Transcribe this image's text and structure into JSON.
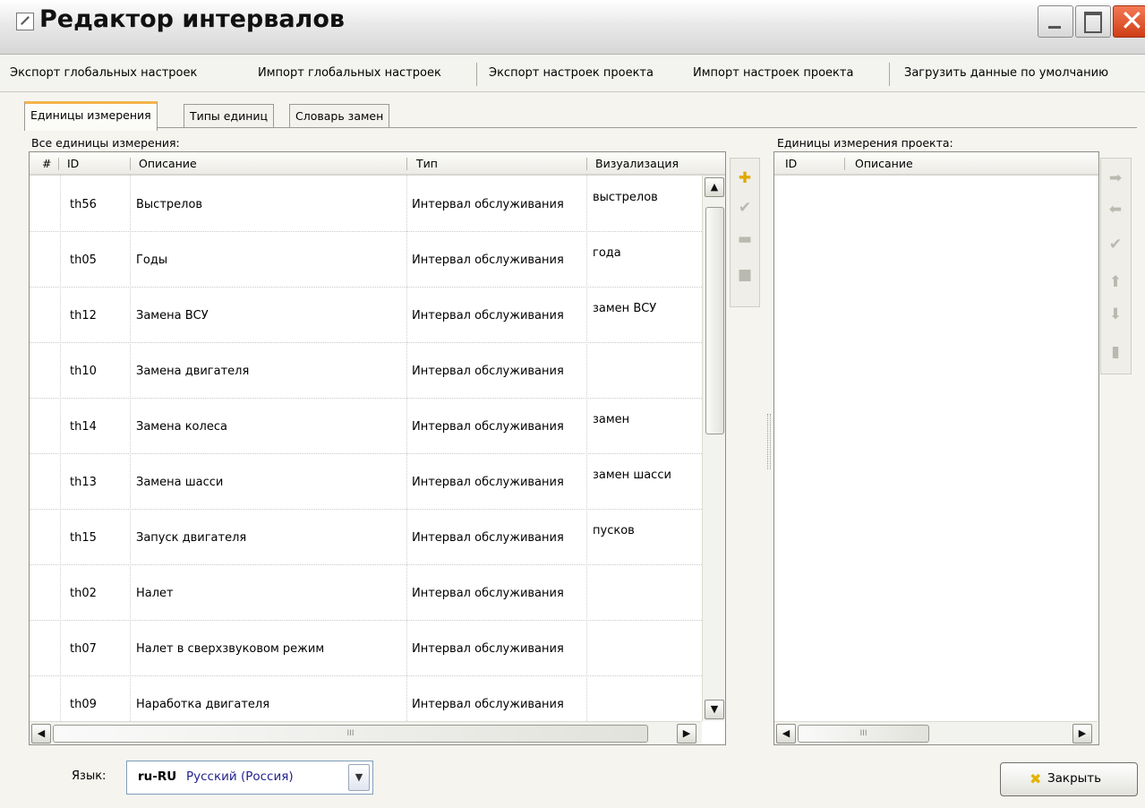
{
  "window": {
    "title": "Редактор интервалов",
    "icons": {
      "app": "editor-icon",
      "minimize": "minimize-icon",
      "maximize": "maximize-icon",
      "close": "close-icon"
    }
  },
  "toolbar": {
    "export_global": "Экспорт глобальных настроек",
    "import_global": "Импорт глобальных настроек",
    "export_project": "Экспорт настроек проекта",
    "import_project": "Импорт настроек проекта",
    "load_defaults": "Загрузить данные по умолчанию"
  },
  "tabs": [
    {
      "label": "Единицы измерения",
      "active": true
    },
    {
      "label": "Типы единиц",
      "active": false
    },
    {
      "label": "Словарь замен",
      "active": false
    }
  ],
  "all_units": {
    "label": "Все единицы измерения:",
    "columns": [
      "#",
      "ID",
      "Описание",
      "Тип",
      "Визуализация"
    ],
    "rows": [
      {
        "id": "th56",
        "description": "Выстрелов",
        "type": "Интервал обслуживания",
        "visual": "выстрелов"
      },
      {
        "id": "th05",
        "description": "Годы",
        "type": "Интервал обслуживания",
        "visual": "года"
      },
      {
        "id": "th12",
        "description": "Замена ВСУ",
        "type": "Интервал обслуживания",
        "visual": "замен  ВСУ"
      },
      {
        "id": "th10",
        "description": "Замена двигателя",
        "type": "Интервал обслуживания",
        "visual": ""
      },
      {
        "id": "th14",
        "description": "Замена колеса",
        "type": "Интервал обслуживания",
        "visual": "замен"
      },
      {
        "id": "th13",
        "description": "Замена шасси",
        "type": "Интервал обслуживания",
        "visual": "замен  шасси"
      },
      {
        "id": "th15",
        "description": "Запуск двигателя",
        "type": "Интервал обслуживания",
        "visual": "пусков"
      },
      {
        "id": "th02",
        "description": "Налет",
        "type": "Интервал обслуживания",
        "visual": ""
      },
      {
        "id": "th07",
        "description": "Налет в сверхзвуковом режим",
        "type": "Интервал обслуживания",
        "visual": ""
      },
      {
        "id": "th09",
        "description": "Наработка двигателя",
        "type": "Интервал обслуживания",
        "visual": ""
      }
    ],
    "scroll": {
      "up": "scroll-up-arrow",
      "down": "scroll-down-arrow",
      "left": "scroll-left-arrow",
      "right": "scroll-right-arrow",
      "grip": "III"
    }
  },
  "middle_tools": [
    {
      "name": "add-icon",
      "glyph": "✚",
      "color": "#e0a800"
    },
    {
      "name": "check-icon",
      "glyph": "✔",
      "color": "#b9b9b0"
    },
    {
      "name": "remove-icon",
      "glyph": "▬",
      "color": "#b9b9b0"
    },
    {
      "name": "block-icon",
      "glyph": "■",
      "color": "#b9b9b0"
    }
  ],
  "project_units": {
    "label": "Единицы измерения проекта:",
    "columns": [
      "ID",
      "Описание"
    ],
    "scroll": {
      "grip": "III"
    }
  },
  "right_tools": [
    {
      "name": "move-right-icon",
      "glyph": "➡"
    },
    {
      "name": "move-left-icon",
      "glyph": "⬅"
    },
    {
      "name": "check-icon",
      "glyph": "✔"
    },
    {
      "name": "move-up-icon",
      "glyph": "⬆"
    },
    {
      "name": "move-down-icon",
      "glyph": "⬇"
    },
    {
      "name": "delete-doc-icon",
      "glyph": "▮"
    }
  ],
  "language": {
    "label": "Язык:",
    "code": "ru-RU",
    "name": "Русский (Россия)"
  },
  "close_button": {
    "label": "Закрыть",
    "icon": "close-x-icon"
  },
  "colors": {
    "accent_tab": "#f3b34b",
    "close_red": "#d9441d",
    "lang_name": "#23238e"
  }
}
